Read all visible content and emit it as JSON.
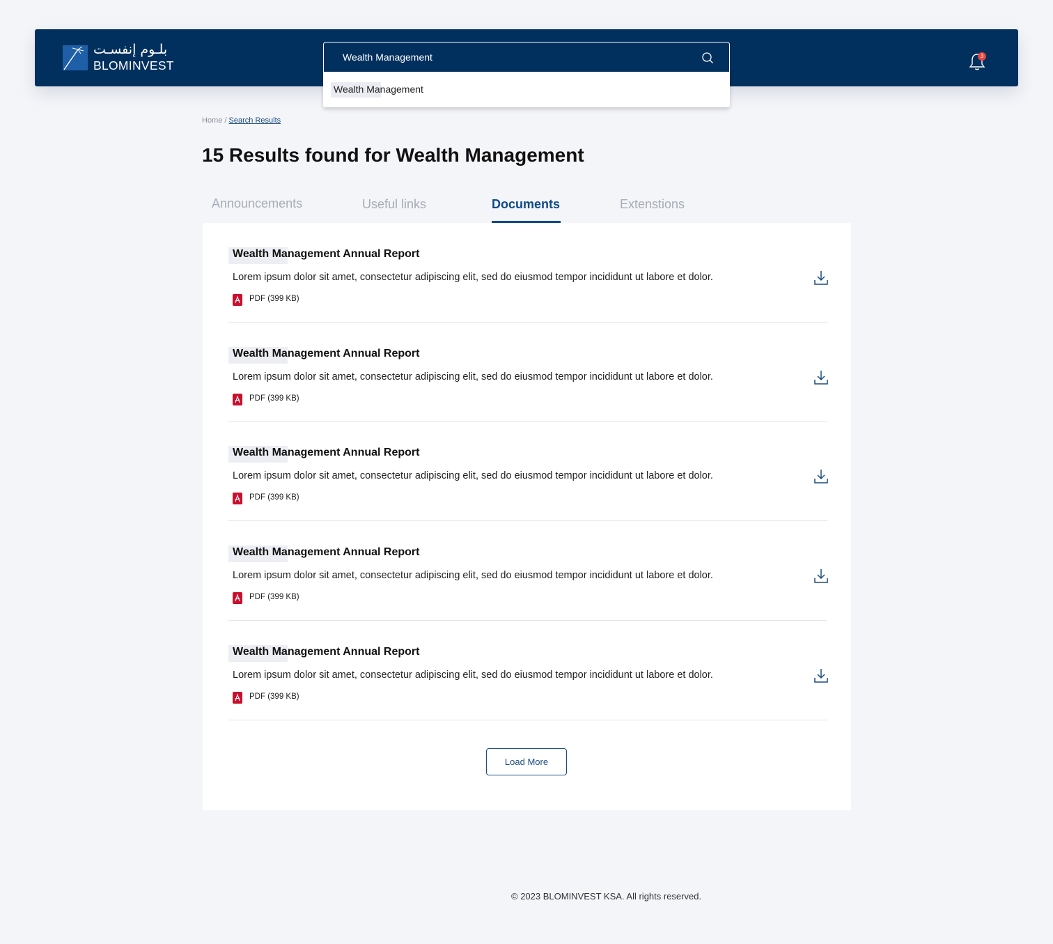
{
  "header": {
    "logo_ar": "بلـوم إنفسـت",
    "logo_en": "BLOMINVEST",
    "search_value": "Wealth Management",
    "notification_count": "3"
  },
  "search_suggestion": "Wealth Management",
  "breadcrumb": {
    "home": "Home",
    "separator": "/",
    "current": "Search Results"
  },
  "page_title": "15 Results found for Wealth Management",
  "tabs": [
    {
      "label": "Announcements",
      "active": false
    },
    {
      "label": "Useful links",
      "active": false
    },
    {
      "label": "Documents",
      "active": true
    },
    {
      "label": "Extenstions",
      "active": false
    }
  ],
  "results": [
    {
      "title": "Wealth Management Annual Report",
      "description": "Lorem ipsum dolor sit amet, consectetur adipiscing elit, sed do eiusmod tempor incididunt ut labore et dolor.",
      "meta": "PDF (399 KB)"
    },
    {
      "title": "Wealth Management Annual Report",
      "description": "Lorem ipsum dolor sit amet, consectetur adipiscing elit, sed do eiusmod tempor incididunt ut labore et dolor.",
      "meta": "PDF (399 KB)"
    },
    {
      "title": "Wealth Management Annual Report",
      "description": "Lorem ipsum dolor sit amet, consectetur adipiscing elit, sed do eiusmod tempor incididunt ut labore et dolor.",
      "meta": "PDF (399 KB)"
    },
    {
      "title": "Wealth Management Annual Report",
      "description": "Lorem ipsum dolor sit amet, consectetur adipiscing elit, sed do eiusmod tempor incididunt ut labore et dolor.",
      "meta": "PDF (399 KB)"
    },
    {
      "title": "Wealth Management Annual Report",
      "description": "Lorem ipsum dolor sit amet, consectetur adipiscing elit, sed do eiusmod tempor incididunt ut labore et dolor.",
      "meta": "PDF (399 KB)"
    }
  ],
  "load_more_label": "Load More",
  "footer": "© 2023 BLOMINVEST KSA. All rights reserved.",
  "colors": {
    "header_bg": "#01305e",
    "accent": "#0e4a8a",
    "pdf_red": "#c8102e",
    "badge_red": "#e8453c"
  }
}
